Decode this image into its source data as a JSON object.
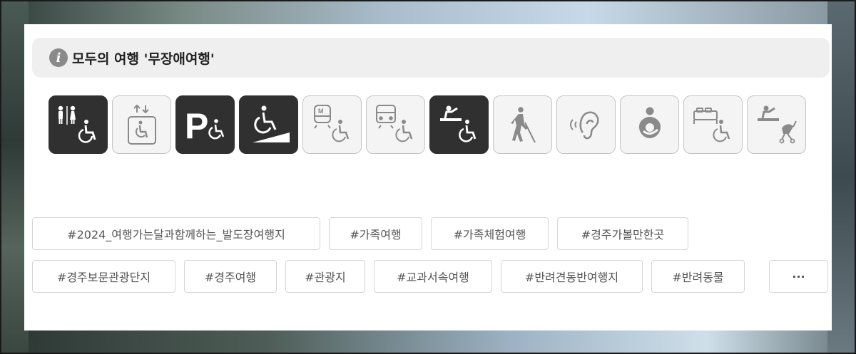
{
  "notice": {
    "title": "모두의 여행 '무장애여행'"
  },
  "accessibility_icons": [
    {
      "name": "accessible-restroom-icon",
      "active": true
    },
    {
      "name": "elevator-icon",
      "active": false
    },
    {
      "name": "accessible-parking-icon",
      "active": true
    },
    {
      "name": "wheelchair-ramp-icon",
      "active": true
    },
    {
      "name": "subway-wheelchair-icon",
      "active": false
    },
    {
      "name": "bus-wheelchair-icon",
      "active": false
    },
    {
      "name": "wheelchair-information-desk-icon",
      "active": true
    },
    {
      "name": "visually-impaired-icon",
      "active": false
    },
    {
      "name": "hearing-impaired-icon",
      "active": false
    },
    {
      "name": "nursing-room-icon",
      "active": false
    },
    {
      "name": "accessible-room-icon",
      "active": false
    },
    {
      "name": "stroller-rental-icon",
      "active": false
    }
  ],
  "tags": {
    "row1": [
      "#2024_여행가는달과함께하는_발도장여행지",
      "#가족여행",
      "#가족체험여행",
      "#경주가볼만한곳"
    ],
    "row2": [
      "#경주보문관광단지",
      "#경주여행",
      "#관광지",
      "#교과서속여행",
      "#반려견동반여행지",
      "#반려동물"
    ],
    "more_label": "···"
  }
}
